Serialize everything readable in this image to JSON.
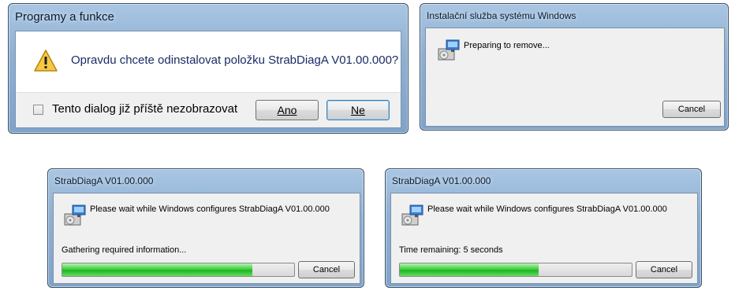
{
  "dialog_uninstall": {
    "title": "Programy a funkce",
    "message": "Opravdu chcete odinstalovat položku StrabDiagA V01.00.000?",
    "checkbox_label": "Tento dialog již příště nezobrazovat",
    "yes_button": "Ano",
    "no_button": "Ne",
    "icon": "warning-icon"
  },
  "dialog_installer_service": {
    "title": "Instalační služba systému Windows",
    "status": "Preparing to remove...",
    "cancel_button": "Cancel",
    "icon": "installer-icon"
  },
  "dialog_configure_1": {
    "title": "StrabDiagA V01.00.000",
    "message": "Please wait while Windows configures StrabDiagA V01.00.000",
    "status": "Gathering required information...",
    "progress": 0.82,
    "cancel_button": "Cancel",
    "icon": "installer-icon"
  },
  "dialog_configure_2": {
    "title": "StrabDiagA V01.00.000",
    "message": "Please wait while Windows configures StrabDiagA V01.00.000",
    "status": "Time remaining: 5 seconds",
    "progress": 0.6,
    "cancel_button": "Cancel",
    "icon": "installer-icon"
  },
  "colors": {
    "title_glass": "#8fb0d2",
    "progress_green": "#2fc22f",
    "default_button_border": "#3c7fb1"
  }
}
